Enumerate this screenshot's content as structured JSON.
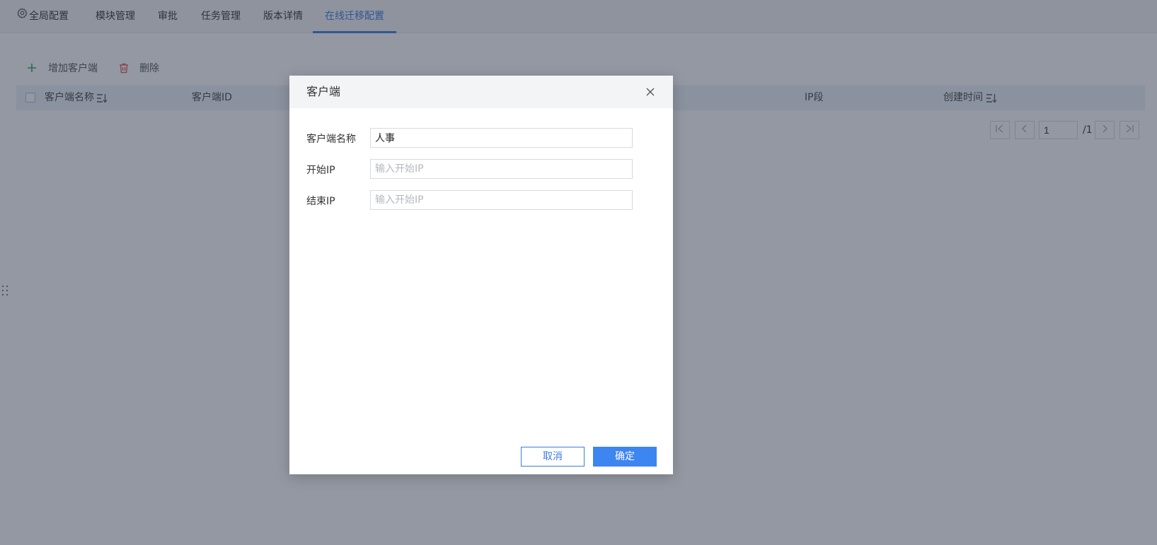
{
  "tabs": [
    {
      "label": "全局配置",
      "icon": "gear-icon"
    },
    {
      "label": "模块管理"
    },
    {
      "label": "审批"
    },
    {
      "label": "任务管理"
    },
    {
      "label": "版本详情"
    },
    {
      "label": "在线迁移配置",
      "active": true
    }
  ],
  "toolbar": {
    "add_label": "增加客户端",
    "delete_label": "删除"
  },
  "table": {
    "columns": [
      "客户端名称",
      "客户端ID",
      "IP段",
      "创建时间"
    ]
  },
  "pagination": {
    "current_page": "1",
    "total_pages": "/1"
  },
  "modal": {
    "title": "客户端",
    "fields": [
      {
        "label": "客户端名称",
        "value": "人事",
        "placeholder": ""
      },
      {
        "label": "开始IP",
        "value": "",
        "placeholder": "输入开始IP"
      },
      {
        "label": "结束IP",
        "value": "",
        "placeholder": "输入开始IP"
      }
    ],
    "cancel_label": "取消",
    "ok_label": "确定"
  },
  "colors": {
    "accent": "#3d7be0",
    "primary_button": "#3d85f0",
    "add_icon": "#2fa84f",
    "delete_icon": "#e05050"
  }
}
